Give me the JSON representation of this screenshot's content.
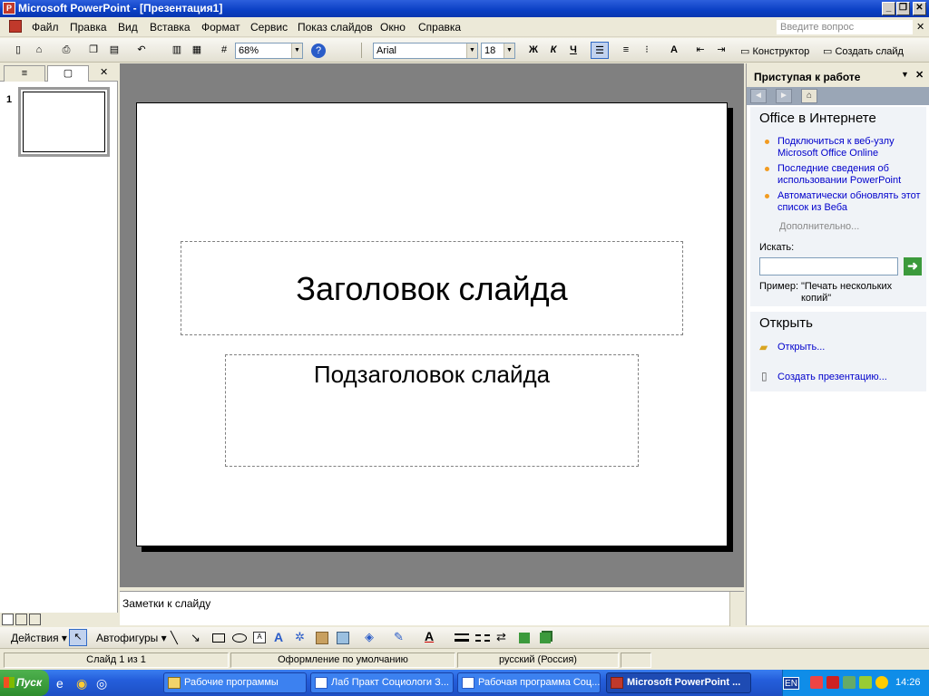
{
  "window": {
    "title": "Microsoft PowerPoint - [Презентация1]",
    "minimize": "_",
    "restore": "❐",
    "close": "✕"
  },
  "menu": {
    "items": [
      "Файл",
      "Правка",
      "Вид",
      "Вставка",
      "Формат",
      "Сервис",
      "Показ слайдов",
      "Окно",
      "Справка"
    ],
    "help_placeholder": "Введите вопрос",
    "doc_close": "✕"
  },
  "toolbar": {
    "zoom": "68%",
    "font": "Arial",
    "font_size": "18",
    "bold": "Ж",
    "italic": "К",
    "underline": "Ч",
    "designer": "Конструктор",
    "new_slide": "Создать слайд"
  },
  "left_pane": {
    "close": "✕",
    "slide_number": "1"
  },
  "slide": {
    "title": "Заголовок слайда",
    "subtitle": "Подзаголовок слайда"
  },
  "notes": {
    "text": "Заметки к слайду"
  },
  "task_pane": {
    "title": "Приступая к работе",
    "section_online": "Office в Интернете",
    "links": [
      "Подключиться к веб-узлу Microsoft Office Online",
      "Последние сведения об использовании PowerPoint",
      "Автоматически обновлять этот список из Веба"
    ],
    "more": "Дополнительно...",
    "search_label": "Искать:",
    "example_label": "Пример:",
    "example_text": "\"Печать нескольких копий\"",
    "section_open": "Открыть",
    "open_link": "Открыть...",
    "create_link": "Создать презентацию..."
  },
  "drawing_toolbar": {
    "actions": "Действия",
    "autoshapes": "Автофигуры"
  },
  "status": {
    "slide": "Слайд 1 из 1",
    "design": "Оформление по умолчанию",
    "language": "русский (Россия)"
  },
  "taskbar": {
    "start": "Пуск",
    "tasks": [
      "Рабочие программы",
      "Лаб Практ Социологи З...",
      "Рабочая программа Соц...",
      "Microsoft PowerPoint ..."
    ],
    "lang": "EN",
    "clock": "14:26"
  },
  "colors": {
    "title_bar": "#0a3fc4",
    "link": "#0000cc",
    "bullet": "#f29b21",
    "taskbar": "#245edb",
    "start": "#2d8c2d"
  }
}
